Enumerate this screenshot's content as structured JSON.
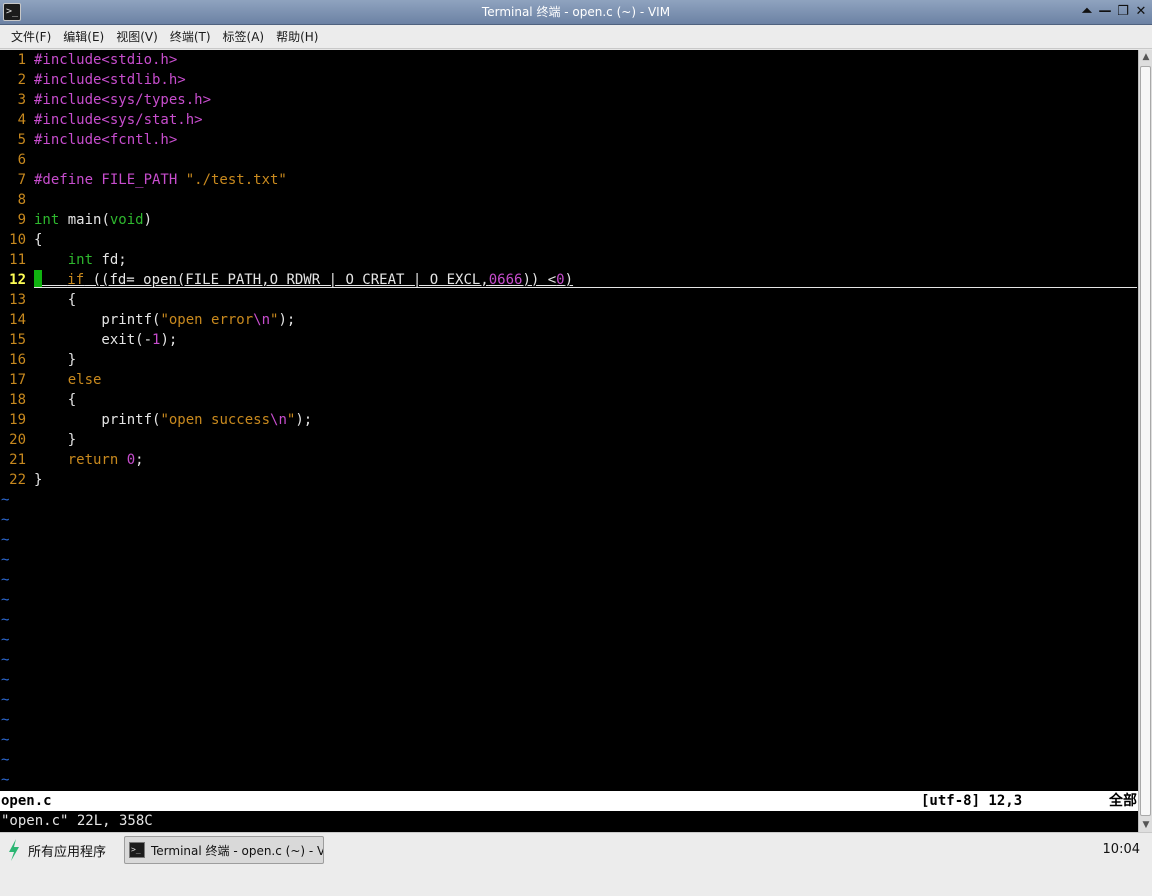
{
  "window": {
    "title": "Terminal 终端 - open.c (~) - VIM",
    "icon": "terminal-icon",
    "buttons": [
      "shade-icon",
      "minimize-icon",
      "maximize-icon",
      "close-icon"
    ]
  },
  "menu": {
    "items": [
      "文件(F)",
      "编辑(E)",
      "视图(V)",
      "终端(T)",
      "标签(A)",
      "帮助(H)"
    ]
  },
  "editor": {
    "current_line": 12,
    "lines": [
      "#include<stdio.h>",
      "#include<stdlib.h>",
      "#include<sys/types.h>",
      "#include<sys/stat.h>",
      "#include<fcntl.h>",
      "",
      "#define FILE_PATH \"./test.txt\"",
      "",
      "int main(void)",
      "{",
      "    int fd;",
      "    if ((fd= open(FILE_PATH,O_RDWR | O_CREAT | O_EXCL,0666)) <0)",
      "    {",
      "        printf(\"open error\\n\");",
      "        exit(-1);",
      "    }",
      "    else",
      "    {",
      "        printf(\"open success\\n\");",
      "    }",
      "    return 0;",
      "}"
    ],
    "empty_line_marker": "~",
    "empty_line_count": 15,
    "colors": {
      "preproc": "#c74dcd",
      "string": "#c8891e",
      "type": "#2eb82e",
      "line_number": "#c8891e",
      "current_line_number": "#ffff55",
      "cursor": "#10b310",
      "tilde": "#2d6bd6"
    }
  },
  "status": {
    "filename": "open.c",
    "encoding_position": "[utf-8] 12,3",
    "scroll": "全部"
  },
  "command_line": "\"open.c\" 22L, 358C",
  "taskbar": {
    "apps_label": "所有应用程序",
    "task_label": "Terminal 终端 - open.c (~) - VIM",
    "clock": "10:04"
  }
}
